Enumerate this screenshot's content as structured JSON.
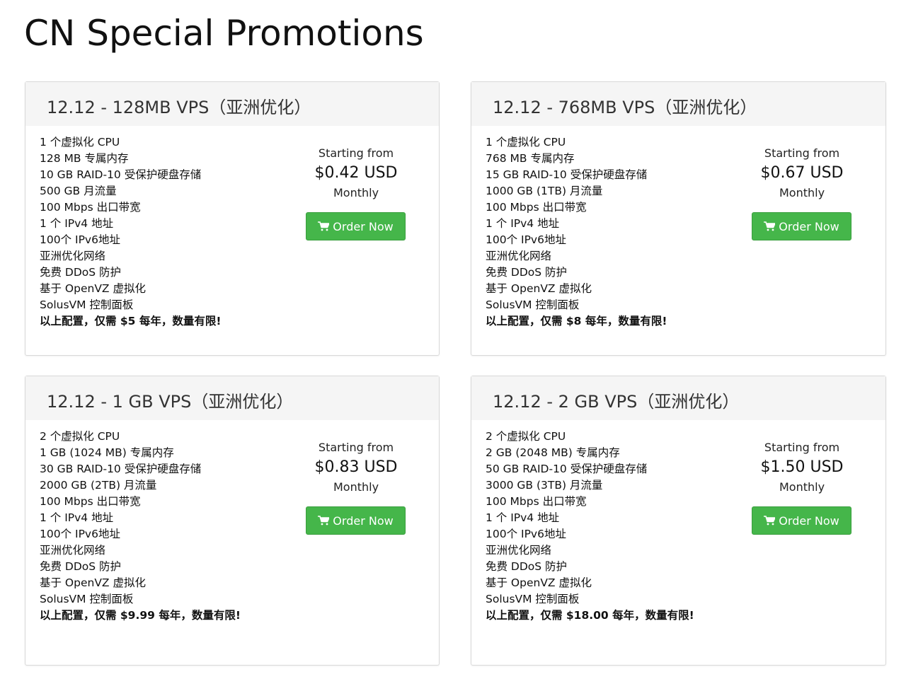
{
  "page": {
    "title": "CN Special Promotions"
  },
  "products": [
    {
      "name": "12.12 - 128MB VPS（亚洲优化）",
      "features": [
        "1 个虚拟化 CPU",
        "128 MB 专属内存",
        "10 GB RAID-10 受保护硬盘存储",
        "500 GB 月流量",
        "100 Mbps 出口带宽",
        "1 个 IPv4 地址",
        "100个 IPv6地址",
        "亚洲优化网络",
        "免费 DDoS 防护",
        "基于 OpenVZ 虚拟化",
        "SolusVM 控制面板",
        "以上配置，仅需 $5 每年，数量有限!"
      ],
      "starting_from": "Starting from",
      "price": "$0.42 USD",
      "cycle": "Monthly",
      "order_label": "Order Now"
    },
    {
      "name": "12.12 - 768MB VPS（亚洲优化）",
      "features": [
        "1 个虚拟化 CPU",
        "768 MB 专属内存",
        "15 GB RAID-10 受保护硬盘存储",
        "1000 GB (1TB) 月流量",
        "100 Mbps 出口带宽",
        "1 个 IPv4 地址",
        "100个 IPv6地址",
        "亚洲优化网络",
        "免费 DDoS 防护",
        "基于 OpenVZ 虚拟化",
        "SolusVM 控制面板",
        "以上配置，仅需 $8 每年，数量有限!"
      ],
      "starting_from": "Starting from",
      "price": "$0.67 USD",
      "cycle": "Monthly",
      "order_label": "Order Now"
    },
    {
      "name": "12.12 - 1 GB VPS（亚洲优化）",
      "features": [
        "2 个虚拟化 CPU",
        "1 GB (1024 MB) 专属内存",
        "30 GB RAID-10 受保护硬盘存储",
        "2000 GB (2TB) 月流量",
        "100 Mbps 出口带宽",
        "1 个 IPv4 地址",
        "100个 IPv6地址",
        "亚洲优化网络",
        "免费 DDoS 防护",
        "基于 OpenVZ 虚拟化",
        "SolusVM 控制面板",
        "以上配置，仅需 $9.99 每年，数量有限!"
      ],
      "starting_from": "Starting from",
      "price": "$0.83 USD",
      "cycle": "Monthly",
      "order_label": "Order Now"
    },
    {
      "name": "12.12 - 2 GB VPS（亚洲优化）",
      "features": [
        "2 个虚拟化 CPU",
        "2 GB (2048 MB) 专属内存",
        "50 GB RAID-10 受保护硬盘存储",
        "3000 GB (3TB) 月流量",
        "100 Mbps 出口带宽",
        "1 个 IPv4 地址",
        "100个 IPv6地址",
        "亚洲优化网络",
        "免费 DDoS 防护",
        "基于 OpenVZ 虚拟化",
        "SolusVM 控制面板",
        "以上配置，仅需 $18.00 每年，数量有限!"
      ],
      "starting_from": "Starting from",
      "price": "$1.50 USD",
      "cycle": "Monthly",
      "order_label": "Order Now"
    }
  ],
  "icons": {
    "order_button": "shopping-cart-icon"
  },
  "colors": {
    "order_button": "#45b64a",
    "card_header": "#f5f5f5"
  }
}
